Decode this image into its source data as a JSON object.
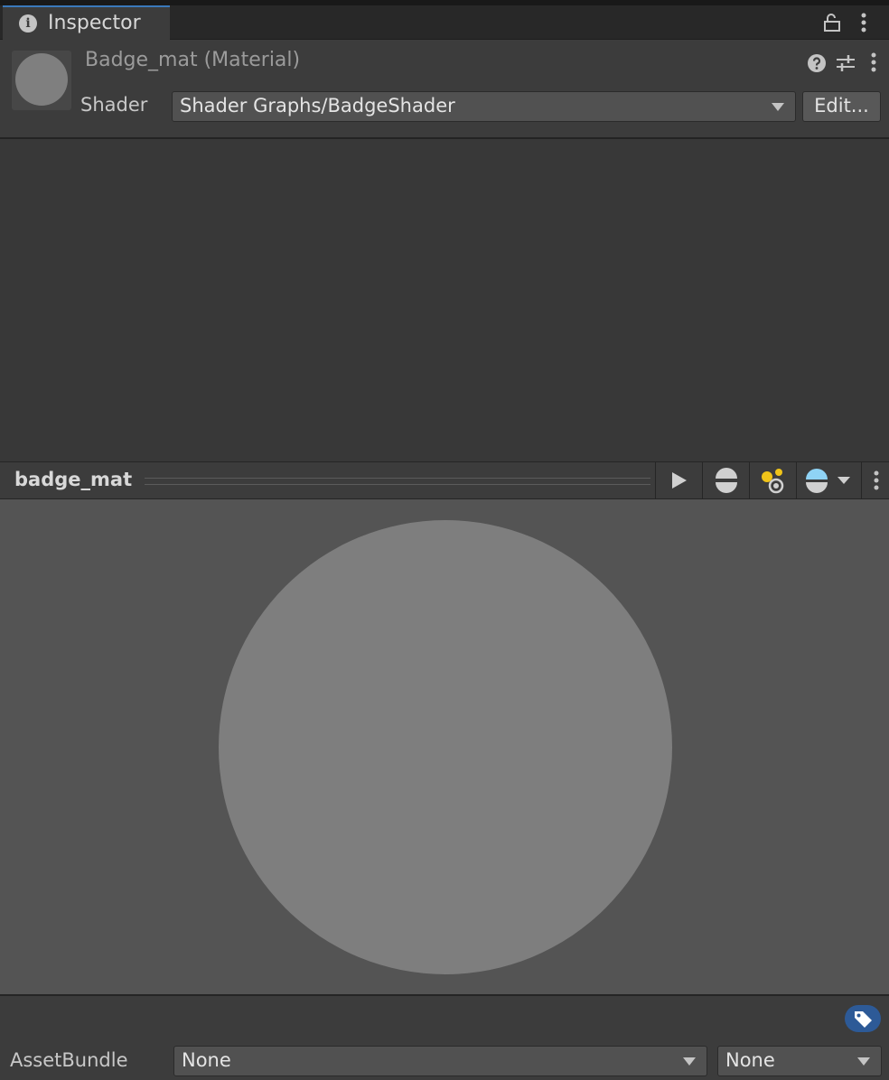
{
  "tab": {
    "title": "Inspector"
  },
  "material": {
    "name": "Badge_mat (Material)",
    "shader_label": "Shader",
    "shader_value": "Shader Graphs/BadgeShader",
    "edit_label": "Edit..."
  },
  "preview": {
    "title": "badge_mat"
  },
  "asset_bundle": {
    "label": "AssetBundle",
    "name_value": "None",
    "variant_value": "None"
  },
  "colors": {
    "accent": "#3a79bb",
    "tag_button": "#2d5a97",
    "light_blue": "#8fd3f5",
    "light_yellow": "#f0c419"
  }
}
